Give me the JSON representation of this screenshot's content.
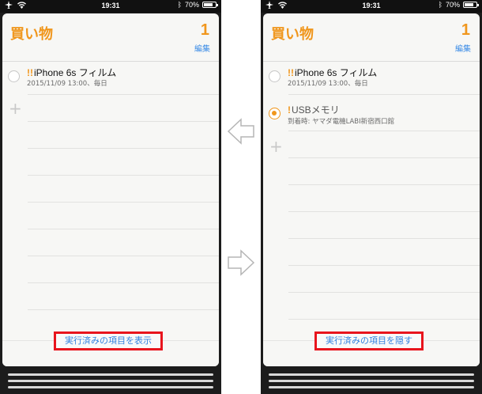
{
  "left": {
    "status": {
      "time": "19:31",
      "battery": "70%",
      "battery_level": 0.7
    },
    "list_title": "買い物",
    "count": "1",
    "edit": "編集",
    "items": [
      {
        "priority": "!!",
        "title": "iPhone 6s フィルム",
        "detail": "2015/11/09 13:00、毎日",
        "completed": false
      }
    ],
    "add": "+",
    "toggle_button": "実行済みの項目を表示"
  },
  "right": {
    "status": {
      "time": "19:31",
      "battery": "70%",
      "battery_level": 0.7
    },
    "list_title": "買い物",
    "count": "1",
    "edit": "編集",
    "items": [
      {
        "priority": "!!",
        "title": "iPhone 6s フィルム",
        "detail": "2015/11/09 13:00、毎日",
        "completed": false
      },
      {
        "priority": "!",
        "title": "USBメモリ",
        "detail": "到着時: ヤマダ電機LABI新宿西口館",
        "completed": true
      }
    ],
    "add": "+",
    "toggle_button": "実行済みの項目を隠す"
  },
  "colors": {
    "accent": "#f0961c",
    "link": "#2f7fde",
    "highlight": "#e8141d"
  },
  "icons": {
    "arrow_left": "arrow-left-icon",
    "arrow_right": "arrow-right-icon"
  }
}
